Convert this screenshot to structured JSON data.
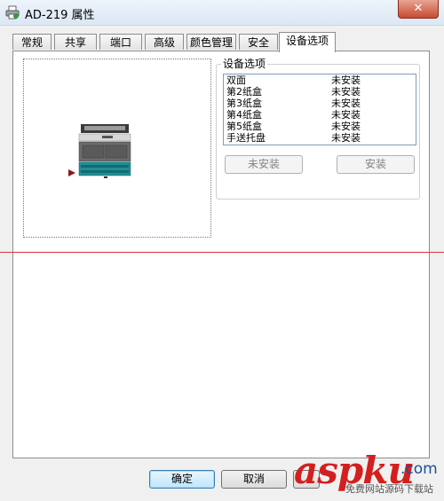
{
  "window": {
    "title": "AD-219 属性",
    "close_label": "✕"
  },
  "tabs": [
    {
      "label": "常规"
    },
    {
      "label": "共享"
    },
    {
      "label": "端口"
    },
    {
      "label": "高级"
    },
    {
      "label": "颜色管理"
    },
    {
      "label": "安全"
    },
    {
      "label": "设备选项",
      "active": true
    }
  ],
  "device_options": {
    "group_label": "设备选项",
    "items": [
      {
        "name": "双面",
        "status": "未安装"
      },
      {
        "name": "第2纸盒",
        "status": "未安装"
      },
      {
        "name": "第3纸盒",
        "status": "未安装"
      },
      {
        "name": "第4纸盒",
        "status": "未安装"
      },
      {
        "name": "第5纸盒",
        "status": "未安装"
      },
      {
        "name": "手送托盘",
        "status": "未安装"
      }
    ],
    "uninstall_button": "未安装",
    "install_button": "安装"
  },
  "footer": {
    "ok": "确定",
    "cancel": "取消"
  },
  "watermark": {
    "brand": "aspku",
    "suffix": ".com",
    "sub": "免费网站源码下载站"
  },
  "colors": {
    "accent_line": "#d8333b",
    "watermark_brand": "#d21f1f"
  },
  "icons": {
    "app": "printer-icon",
    "preview": "printer-machine-image",
    "pointer": "arrow-right-icon"
  }
}
